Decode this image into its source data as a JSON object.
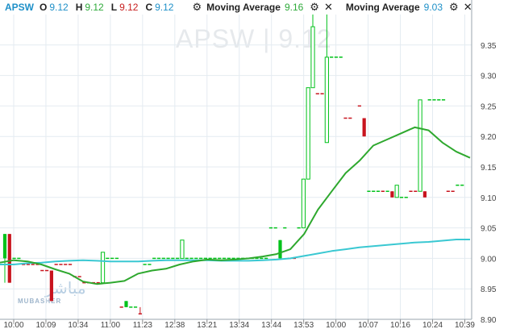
{
  "header": {
    "symbol": "APSW",
    "ohlc": [
      {
        "label": "O",
        "value": "9.12",
        "color": "#1e90c8"
      },
      {
        "label": "H",
        "value": "9.12",
        "color": "#2eaa3a"
      },
      {
        "label": "L",
        "value": "9.12",
        "color": "#c81e1e"
      },
      {
        "label": "C",
        "value": "9.12",
        "color": "#1e90c8"
      }
    ],
    "indicators": [
      {
        "label": "Moving Average",
        "value": "9.16",
        "value_color": "#2eaa3a"
      },
      {
        "label": "Moving Average",
        "value": "9.03",
        "value_color": "#1e90c8"
      }
    ]
  },
  "watermark": {
    "text": "APSW  |  9.12",
    "logo_arabic": "مباشر",
    "logo_english": "MUBASHER"
  },
  "colors": {
    "up": "#00c21a",
    "down": "#c8141e",
    "ma_fast": "#2ea82e",
    "ma_slow": "#3ac8d2",
    "grid": "#e4ebf1",
    "axis_text": "#444444"
  },
  "chart_data": {
    "type": "candlestick",
    "title": "",
    "xlabel": "",
    "ylabel": "",
    "ylim": [
      8.9,
      9.4
    ],
    "y_ticks": [
      "8.90",
      "8.95",
      "9.00",
      "9.05",
      "9.10",
      "9.15",
      "9.20",
      "9.25",
      "9.30",
      "9.35"
    ],
    "x_ticks": [
      "10:00",
      "10:09",
      "10:34",
      "11:00",
      "11:23",
      "12:38",
      "13:21",
      "13:34",
      "13:44",
      "13:53",
      "10:00",
      "10:07",
      "10:16",
      "10:24",
      "10:39"
    ],
    "bar_count": 100,
    "candles": [
      {
        "i": 0,
        "o": 9.0,
        "h": 9.04,
        "l": 8.96,
        "c": 9.04,
        "dir": "up"
      },
      {
        "i": 1,
        "o": 9.04,
        "h": 9.04,
        "l": 8.96,
        "c": 8.96,
        "dir": "down"
      },
      {
        "i": 2,
        "o": 9.0,
        "h": 9.0,
        "l": 9.0,
        "c": 9.0,
        "dir": "up",
        "doji": true
      },
      {
        "i": 3,
        "o": 9.0,
        "h": 9.0,
        "l": 9.0,
        "c": 9.0,
        "dir": "up",
        "doji": true
      },
      {
        "i": 4,
        "o": 8.99,
        "h": 8.99,
        "l": 8.99,
        "c": 8.99,
        "dir": "down",
        "doji": true
      },
      {
        "i": 5,
        "o": 8.99,
        "h": 8.99,
        "l": 8.99,
        "c": 8.99,
        "dir": "down",
        "doji": true
      },
      {
        "i": 6,
        "o": 8.99,
        "h": 8.99,
        "l": 8.99,
        "c": 8.99,
        "dir": "down",
        "doji": true
      },
      {
        "i": 7,
        "o": 8.99,
        "h": 8.99,
        "l": 8.99,
        "c": 8.99,
        "dir": "down",
        "doji": true
      },
      {
        "i": 8,
        "o": 8.98,
        "h": 8.98,
        "l": 8.98,
        "c": 8.98,
        "dir": "down",
        "doji": true
      },
      {
        "i": 9,
        "o": 8.98,
        "h": 8.98,
        "l": 8.98,
        "c": 8.98,
        "dir": "down",
        "doji": true
      },
      {
        "i": 10,
        "o": 8.98,
        "h": 8.98,
        "l": 8.93,
        "c": 8.93,
        "dir": "down"
      },
      {
        "i": 11,
        "o": 8.99,
        "h": 8.99,
        "l": 8.99,
        "c": 8.99,
        "dir": "down",
        "doji": true
      },
      {
        "i": 12,
        "o": 8.99,
        "h": 8.99,
        "l": 8.99,
        "c": 8.99,
        "dir": "down",
        "doji": true
      },
      {
        "i": 13,
        "o": 8.99,
        "h": 8.99,
        "l": 8.99,
        "c": 8.99,
        "dir": "down",
        "doji": true
      },
      {
        "i": 14,
        "o": 8.99,
        "h": 8.99,
        "l": 8.99,
        "c": 8.99,
        "dir": "down",
        "doji": true
      },
      {
        "i": 15,
        "o": 8.97,
        "h": 8.97,
        "l": 8.97,
        "c": 8.97,
        "dir": "down",
        "doji": true
      },
      {
        "i": 16,
        "o": 8.97,
        "h": 8.97,
        "l": 8.97,
        "c": 8.97,
        "dir": "down",
        "doji": true
      },
      {
        "i": 17,
        "o": 8.96,
        "h": 8.96,
        "l": 8.96,
        "c": 8.96,
        "dir": "down",
        "doji": true
      },
      {
        "i": 18,
        "o": 8.96,
        "h": 8.96,
        "l": 8.96,
        "c": 8.96,
        "dir": "down",
        "doji": true
      },
      {
        "i": 19,
        "o": 8.96,
        "h": 8.96,
        "l": 8.96,
        "c": 8.96,
        "dir": "down",
        "doji": true
      },
      {
        "i": 20,
        "o": 8.96,
        "h": 8.96,
        "l": 8.96,
        "c": 8.96,
        "dir": "down",
        "doji": true
      },
      {
        "i": 21,
        "o": 8.96,
        "h": 9.01,
        "l": 8.96,
        "c": 9.01,
        "dir": "up",
        "hollow": true
      },
      {
        "i": 22,
        "o": 9.0,
        "h": 9.0,
        "l": 9.0,
        "c": 9.0,
        "dir": "up",
        "doji": true
      },
      {
        "i": 23,
        "o": 9.0,
        "h": 9.0,
        "l": 9.0,
        "c": 9.0,
        "dir": "up",
        "doji": true
      },
      {
        "i": 24,
        "o": 9.0,
        "h": 9.0,
        "l": 9.0,
        "c": 9.0,
        "dir": "up",
        "doji": true
      },
      {
        "i": 25,
        "o": 8.92,
        "h": 8.92,
        "l": 8.92,
        "c": 8.92,
        "dir": "down",
        "doji": true
      },
      {
        "i": 26,
        "o": 8.92,
        "h": 8.93,
        "l": 8.92,
        "c": 8.93,
        "dir": "up"
      },
      {
        "i": 27,
        "o": 8.92,
        "h": 8.92,
        "l": 8.92,
        "c": 8.92,
        "dir": "up",
        "doji": true
      },
      {
        "i": 28,
        "o": 8.92,
        "h": 8.92,
        "l": 8.92,
        "c": 8.92,
        "dir": "up",
        "doji": true
      },
      {
        "i": 29,
        "o": 8.91,
        "h": 8.92,
        "l": 8.91,
        "c": 8.91,
        "dir": "down"
      },
      {
        "i": 30,
        "o": 8.99,
        "h": 8.99,
        "l": 8.99,
        "c": 8.99,
        "dir": "up",
        "doji": true
      },
      {
        "i": 31,
        "o": 8.99,
        "h": 8.99,
        "l": 8.99,
        "c": 8.99,
        "dir": "up",
        "doji": true
      },
      {
        "i": 32,
        "o": 9.0,
        "h": 9.0,
        "l": 9.0,
        "c": 9.0,
        "dir": "up",
        "doji": true
      },
      {
        "i": 33,
        "o": 9.0,
        "h": 9.0,
        "l": 9.0,
        "c": 9.0,
        "dir": "up",
        "doji": true
      },
      {
        "i": 34,
        "o": 9.0,
        "h": 9.0,
        "l": 9.0,
        "c": 9.0,
        "dir": "up",
        "doji": true
      },
      {
        "i": 35,
        "o": 9.0,
        "h": 9.0,
        "l": 9.0,
        "c": 9.0,
        "dir": "up",
        "doji": true
      },
      {
        "i": 36,
        "o": 9.0,
        "h": 9.0,
        "l": 9.0,
        "c": 9.0,
        "dir": "up",
        "doji": true
      },
      {
        "i": 37,
        "o": 9.0,
        "h": 9.0,
        "l": 9.0,
        "c": 9.0,
        "dir": "up",
        "doji": true
      },
      {
        "i": 38,
        "o": 9.0,
        "h": 9.03,
        "l": 9.0,
        "c": 9.03,
        "dir": "up",
        "hollow": true
      },
      {
        "i": 39,
        "o": 9.0,
        "h": 9.0,
        "l": 9.0,
        "c": 9.0,
        "dir": "up",
        "doji": true
      },
      {
        "i": 40,
        "o": 9.0,
        "h": 9.0,
        "l": 9.0,
        "c": 9.0,
        "dir": "up",
        "doji": true
      },
      {
        "i": 41,
        "o": 9.0,
        "h": 9.0,
        "l": 9.0,
        "c": 9.0,
        "dir": "up",
        "doji": true
      },
      {
        "i": 42,
        "o": 9.0,
        "h": 9.0,
        "l": 9.0,
        "c": 9.0,
        "dir": "up",
        "doji": true
      },
      {
        "i": 43,
        "o": 9.0,
        "h": 9.0,
        "l": 9.0,
        "c": 9.0,
        "dir": "up",
        "doji": true
      },
      {
        "i": 44,
        "o": 9.0,
        "h": 9.0,
        "l": 9.0,
        "c": 9.0,
        "dir": "up",
        "doji": true
      },
      {
        "i": 45,
        "o": 9.0,
        "h": 9.0,
        "l": 9.0,
        "c": 9.0,
        "dir": "up",
        "doji": true
      },
      {
        "i": 46,
        "o": 9.0,
        "h": 9.0,
        "l": 9.0,
        "c": 9.0,
        "dir": "up",
        "doji": true
      },
      {
        "i": 47,
        "o": 9.0,
        "h": 9.0,
        "l": 9.0,
        "c": 9.0,
        "dir": "up",
        "doji": true
      },
      {
        "i": 48,
        "o": 9.0,
        "h": 9.0,
        "l": 9.0,
        "c": 9.0,
        "dir": "up",
        "doji": true
      },
      {
        "i": 49,
        "o": 9.0,
        "h": 9.0,
        "l": 9.0,
        "c": 9.0,
        "dir": "up",
        "doji": true
      },
      {
        "i": 50,
        "o": 9.0,
        "h": 9.0,
        "l": 9.0,
        "c": 9.0,
        "dir": "up",
        "doji": true
      },
      {
        "i": 51,
        "o": 9.0,
        "h": 9.0,
        "l": 9.0,
        "c": 9.0,
        "dir": "up",
        "doji": true
      },
      {
        "i": 52,
        "o": 9.0,
        "h": 9.0,
        "l": 9.0,
        "c": 9.0,
        "dir": "up",
        "doji": true
      },
      {
        "i": 53,
        "o": 9.0,
        "h": 9.0,
        "l": 9.0,
        "c": 9.0,
        "dir": "up",
        "doji": true
      },
      {
        "i": 54,
        "o": 9.0,
        "h": 9.0,
        "l": 9.0,
        "c": 9.0,
        "dir": "up",
        "doji": true
      },
      {
        "i": 55,
        "o": 9.0,
        "h": 9.0,
        "l": 9.0,
        "c": 9.0,
        "dir": "up",
        "doji": true
      },
      {
        "i": 56,
        "o": 9.0,
        "h": 9.0,
        "l": 9.0,
        "c": 9.0,
        "dir": "up",
        "doji": true
      },
      {
        "i": 57,
        "o": 9.05,
        "h": 9.05,
        "l": 9.05,
        "c": 9.05,
        "dir": "up",
        "doji": true
      },
      {
        "i": 58,
        "o": 9.05,
        "h": 9.05,
        "l": 9.05,
        "c": 9.05,
        "dir": "up",
        "doji": true
      },
      {
        "i": 59,
        "o": 9.0,
        "h": 9.03,
        "l": 9.0,
        "c": 9.03,
        "dir": "up"
      },
      {
        "i": 60,
        "o": 9.05,
        "h": 9.05,
        "l": 9.05,
        "c": 9.05,
        "dir": "up",
        "doji": true
      },
      {
        "i": 61,
        "o": 9.0,
        "h": 9.0,
        "l": 9.0,
        "c": 9.0,
        "dir": "down",
        "doji": true
      },
      {
        "i": 62,
        "o": 9.0,
        "h": 9.0,
        "l": 9.0,
        "c": 9.0,
        "dir": "down",
        "doji": true
      },
      {
        "i": 63,
        "o": 9.05,
        "h": 9.05,
        "l": 9.05,
        "c": 9.05,
        "dir": "up",
        "doji": true
      },
      {
        "i": 64,
        "o": 9.05,
        "h": 9.13,
        "l": 9.05,
        "c": 9.13,
        "dir": "up",
        "hollow": true
      },
      {
        "i": 65,
        "o": 9.13,
        "h": 9.28,
        "l": 9.13,
        "c": 9.28,
        "dir": "up",
        "hollow": true
      },
      {
        "i": 66,
        "o": 9.28,
        "h": 9.4,
        "l": 9.28,
        "c": 9.38,
        "dir": "up",
        "hollow": true
      },
      {
        "i": 67,
        "o": 9.27,
        "h": 9.27,
        "l": 9.27,
        "c": 9.27,
        "dir": "down",
        "doji": true
      },
      {
        "i": 68,
        "o": 9.27,
        "h": 9.27,
        "l": 9.27,
        "c": 9.27,
        "dir": "down",
        "doji": true
      },
      {
        "i": 69,
        "o": 9.19,
        "h": 9.4,
        "l": 9.19,
        "c": 9.33,
        "dir": "up",
        "hollow": true
      },
      {
        "i": 70,
        "o": 9.33,
        "h": 9.33,
        "l": 9.33,
        "c": 9.33,
        "dir": "up",
        "doji": true
      },
      {
        "i": 71,
        "o": 9.33,
        "h": 9.33,
        "l": 9.33,
        "c": 9.33,
        "dir": "up",
        "doji": true
      },
      {
        "i": 72,
        "o": 9.33,
        "h": 9.33,
        "l": 9.33,
        "c": 9.33,
        "dir": "up",
        "doji": true
      },
      {
        "i": 73,
        "o": 9.23,
        "h": 9.23,
        "l": 9.23,
        "c": 9.23,
        "dir": "down",
        "doji": true
      },
      {
        "i": 74,
        "o": 9.23,
        "h": 9.23,
        "l": 9.23,
        "c": 9.23,
        "dir": "down",
        "doji": true
      },
      {
        "i": 76,
        "o": 9.25,
        "h": 9.25,
        "l": 9.25,
        "c": 9.25,
        "dir": "down",
        "doji": true
      },
      {
        "i": 77,
        "o": 9.23,
        "h": 9.23,
        "l": 9.2,
        "c": 9.2,
        "dir": "down"
      },
      {
        "i": 78,
        "o": 9.11,
        "h": 9.11,
        "l": 9.11,
        "c": 9.11,
        "dir": "up",
        "doji": true
      },
      {
        "i": 79,
        "o": 9.11,
        "h": 9.11,
        "l": 9.11,
        "c": 9.11,
        "dir": "up",
        "doji": true
      },
      {
        "i": 80,
        "o": 9.11,
        "h": 9.11,
        "l": 9.11,
        "c": 9.11,
        "dir": "up",
        "doji": true
      },
      {
        "i": 81,
        "o": 9.11,
        "h": 9.11,
        "l": 9.11,
        "c": 9.11,
        "dir": "down",
        "doji": true
      },
      {
        "i": 82,
        "o": 9.11,
        "h": 9.11,
        "l": 9.11,
        "c": 9.11,
        "dir": "up",
        "doji": true
      },
      {
        "i": 83,
        "o": 9.11,
        "h": 9.11,
        "l": 9.1,
        "c": 9.1,
        "dir": "down"
      },
      {
        "i": 84,
        "o": 9.1,
        "h": 9.12,
        "l": 9.1,
        "c": 9.12,
        "dir": "up",
        "hollow": true
      },
      {
        "i": 85,
        "o": 9.1,
        "h": 9.1,
        "l": 9.1,
        "c": 9.1,
        "dir": "up",
        "doji": true
      },
      {
        "i": 86,
        "o": 9.1,
        "h": 9.1,
        "l": 9.1,
        "c": 9.1,
        "dir": "up",
        "doji": true
      },
      {
        "i": 87,
        "o": 9.11,
        "h": 9.11,
        "l": 9.11,
        "c": 9.11,
        "dir": "down",
        "doji": true
      },
      {
        "i": 88,
        "o": 9.11,
        "h": 9.11,
        "l": 9.11,
        "c": 9.11,
        "dir": "down",
        "doji": true
      },
      {
        "i": 89,
        "o": 9.11,
        "h": 9.26,
        "l": 9.11,
        "c": 9.26,
        "dir": "up",
        "hollow": true
      },
      {
        "i": 90,
        "o": 9.11,
        "h": 9.11,
        "l": 9.1,
        "c": 9.1,
        "dir": "down"
      },
      {
        "i": 91,
        "o": 9.26,
        "h": 9.26,
        "l": 9.26,
        "c": 9.26,
        "dir": "up",
        "doji": true
      },
      {
        "i": 92,
        "o": 9.26,
        "h": 9.26,
        "l": 9.26,
        "c": 9.26,
        "dir": "up",
        "doji": true
      },
      {
        "i": 93,
        "o": 9.26,
        "h": 9.26,
        "l": 9.26,
        "c": 9.26,
        "dir": "up",
        "doji": true
      },
      {
        "i": 94,
        "o": 9.26,
        "h": 9.26,
        "l": 9.26,
        "c": 9.26,
        "dir": "up",
        "doji": true
      },
      {
        "i": 95,
        "o": 9.11,
        "h": 9.11,
        "l": 9.11,
        "c": 9.11,
        "dir": "down",
        "doji": true
      },
      {
        "i": 96,
        "o": 9.11,
        "h": 9.11,
        "l": 9.11,
        "c": 9.11,
        "dir": "down",
        "doji": true
      },
      {
        "i": 97,
        "o": 9.12,
        "h": 9.12,
        "l": 9.12,
        "c": 9.12,
        "dir": "up",
        "doji": true
      },
      {
        "i": 98,
        "o": 9.12,
        "h": 9.12,
        "l": 9.12,
        "c": 9.12,
        "dir": "up",
        "doji": true
      }
    ],
    "series": [
      {
        "name": "Moving Average",
        "values": [
          8.993,
          8.997,
          8.995,
          8.99,
          8.982,
          8.975,
          8.962,
          8.958,
          8.96,
          8.963,
          8.975,
          8.98,
          8.983,
          8.99,
          8.995,
          8.998,
          8.997,
          8.998,
          9.0,
          9.003,
          9.007,
          9.015,
          9.04,
          9.08,
          9.11,
          9.14,
          9.16,
          9.185,
          9.195,
          9.205,
          9.215,
          9.21,
          9.19,
          9.175,
          9.165
        ]
      },
      {
        "name": "Moving Average",
        "values": [
          8.99,
          8.99,
          8.992,
          8.993,
          8.995,
          8.996,
          8.997,
          8.996,
          8.995,
          8.995,
          8.995,
          8.996,
          8.997,
          8.997,
          8.997,
          8.997,
          8.996,
          8.996,
          8.996,
          8.997,
          8.998,
          9.0,
          9.004,
          9.008,
          9.012,
          9.015,
          9.018,
          9.02,
          9.022,
          9.024,
          9.026,
          9.027,
          9.029,
          9.031,
          9.031
        ]
      }
    ]
  }
}
